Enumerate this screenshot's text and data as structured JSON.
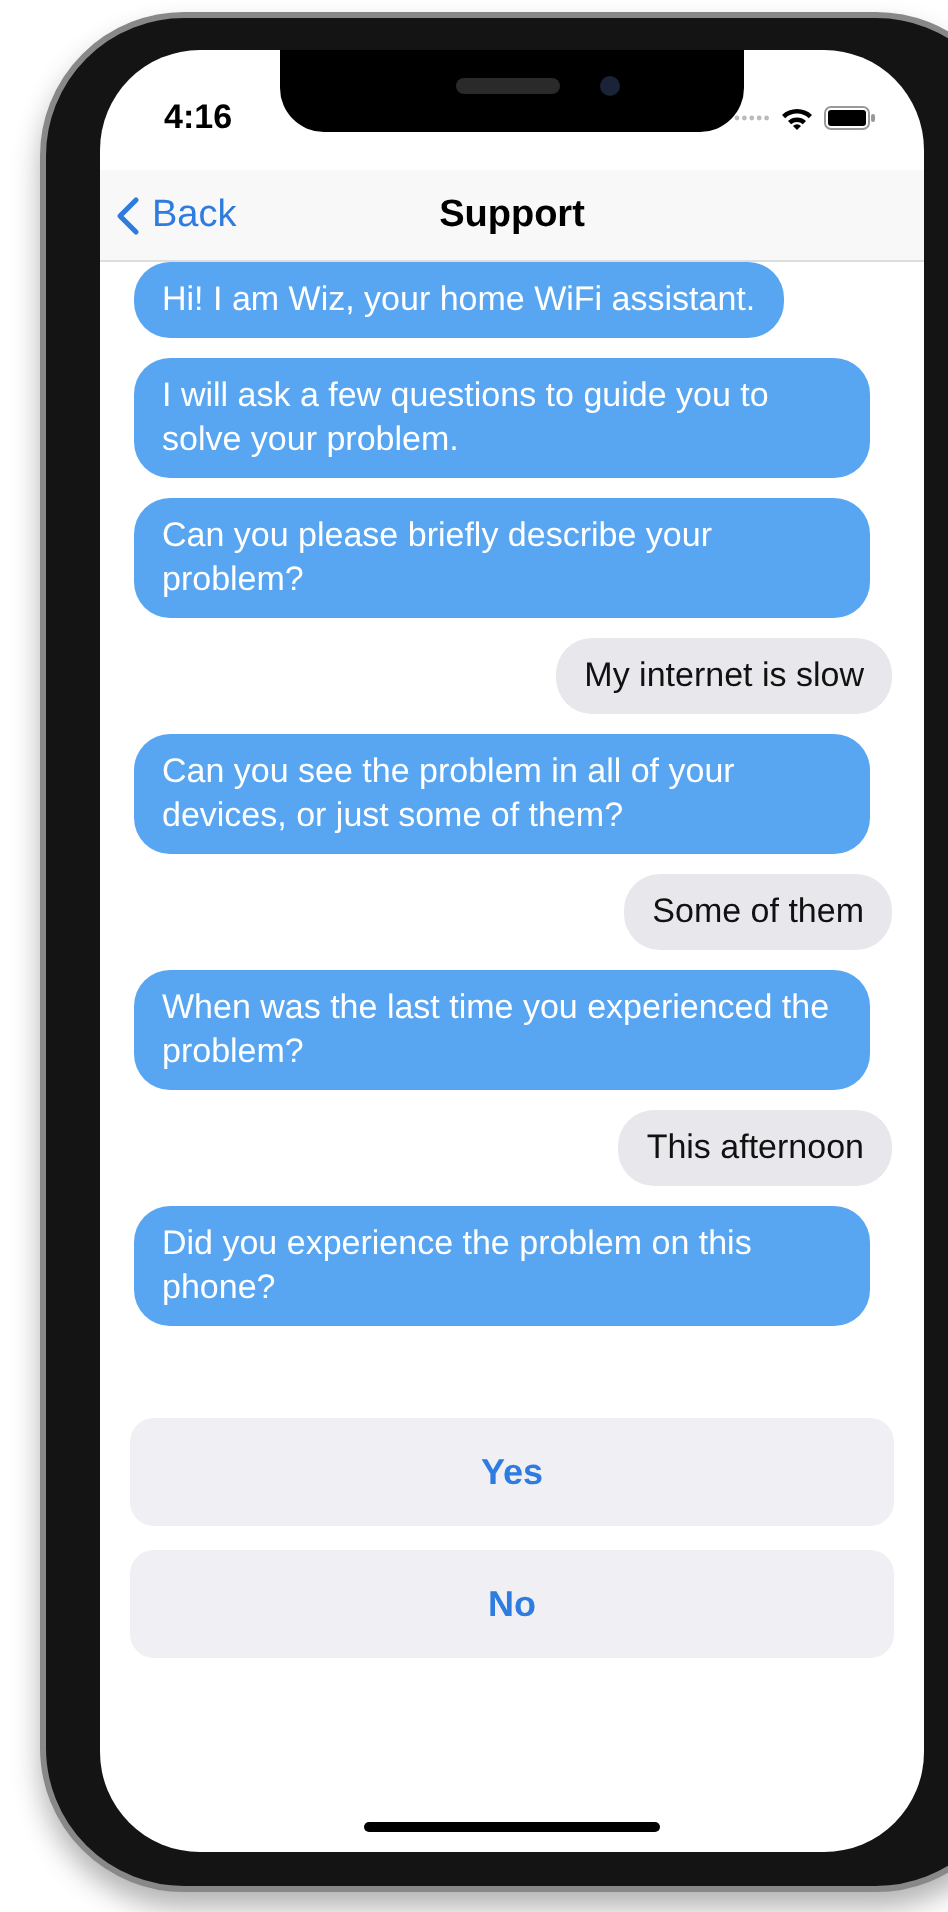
{
  "status_bar": {
    "time": "4:16"
  },
  "nav": {
    "back": "Back",
    "title": "Support"
  },
  "messages": [
    {
      "kind": "bot",
      "text": "Hi! I am Wiz, your home WiFi assistant."
    },
    {
      "kind": "bot",
      "text": "I will ask a few questions to guide you to solve your problem."
    },
    {
      "kind": "bot",
      "text": "Can you please briefly describe your problem?"
    },
    {
      "kind": "user",
      "text": "My internet is slow"
    },
    {
      "kind": "bot",
      "text": "Can you see the problem in all of your devices, or just some of them?"
    },
    {
      "kind": "user",
      "text": "Some of them"
    },
    {
      "kind": "bot",
      "text": "When was the last time you experienced the problem?"
    },
    {
      "kind": "user",
      "text": "This afternoon"
    },
    {
      "kind": "bot",
      "text": "Did you experience the problem on this phone?"
    }
  ],
  "answers": [
    "Yes",
    "No"
  ]
}
